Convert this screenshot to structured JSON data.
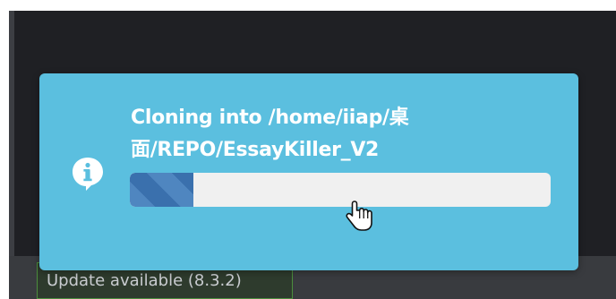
{
  "toast": {
    "message": "Cloning into /home/iiap/桌面/REPO/EssayKiller_V2",
    "progress": 0.15,
    "icon": "info-icon",
    "background_color": "#5bbfdf"
  },
  "status_bar": {
    "update_label": "Update available (8.3.2)"
  },
  "cursor": {
    "icon": "hand-pointer-icon"
  }
}
